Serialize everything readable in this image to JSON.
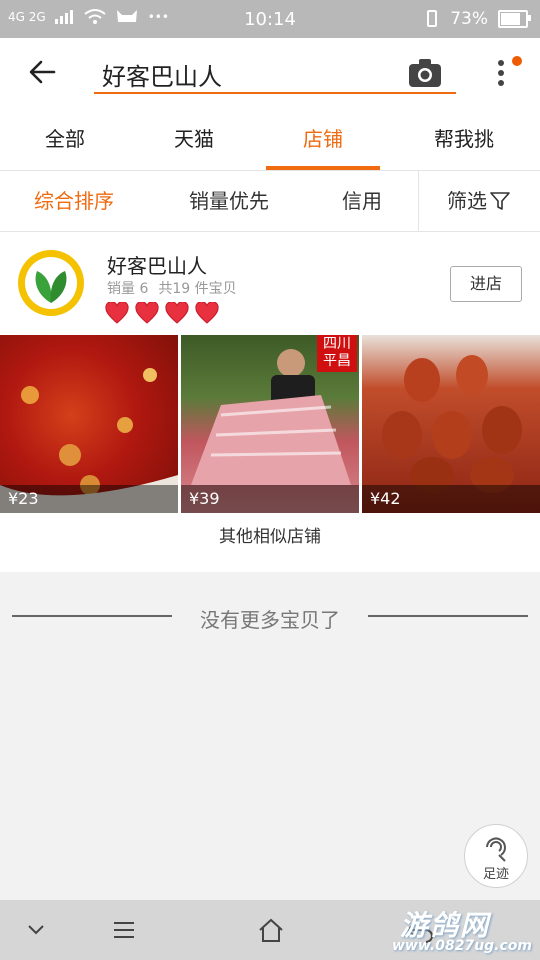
{
  "status_bar": {
    "network": "4G 2G",
    "time": "10:14",
    "battery": "73%",
    "battery_level": 0.73
  },
  "search": {
    "query": "好客巴山人"
  },
  "tabs": [
    {
      "label": "全部",
      "active": false
    },
    {
      "label": "天猫",
      "active": false
    },
    {
      "label": "店铺",
      "active": true
    },
    {
      "label": "帮我挑",
      "active": false
    }
  ],
  "sort": {
    "items": [
      "综合排序",
      "销量优先",
      "信用"
    ],
    "filter_label": "筛选"
  },
  "shop": {
    "name": "好客巴山人",
    "sales": "销量 6",
    "items_count": "共19 件宝贝",
    "hearts": 4,
    "enter_label": "进店",
    "products": [
      {
        "price": "¥23"
      },
      {
        "price": "¥39",
        "tag": "四川平昌"
      },
      {
        "price": "¥42"
      }
    ],
    "similar_label": "其他相似店铺"
  },
  "no_more_label": "没有更多宝贝了",
  "footprint_label": "足迹",
  "watermark": {
    "title": "游鸽网",
    "url": "www.0827ug.com"
  },
  "colors": {
    "accent": "#f06a10",
    "heart": "#e8303e"
  }
}
